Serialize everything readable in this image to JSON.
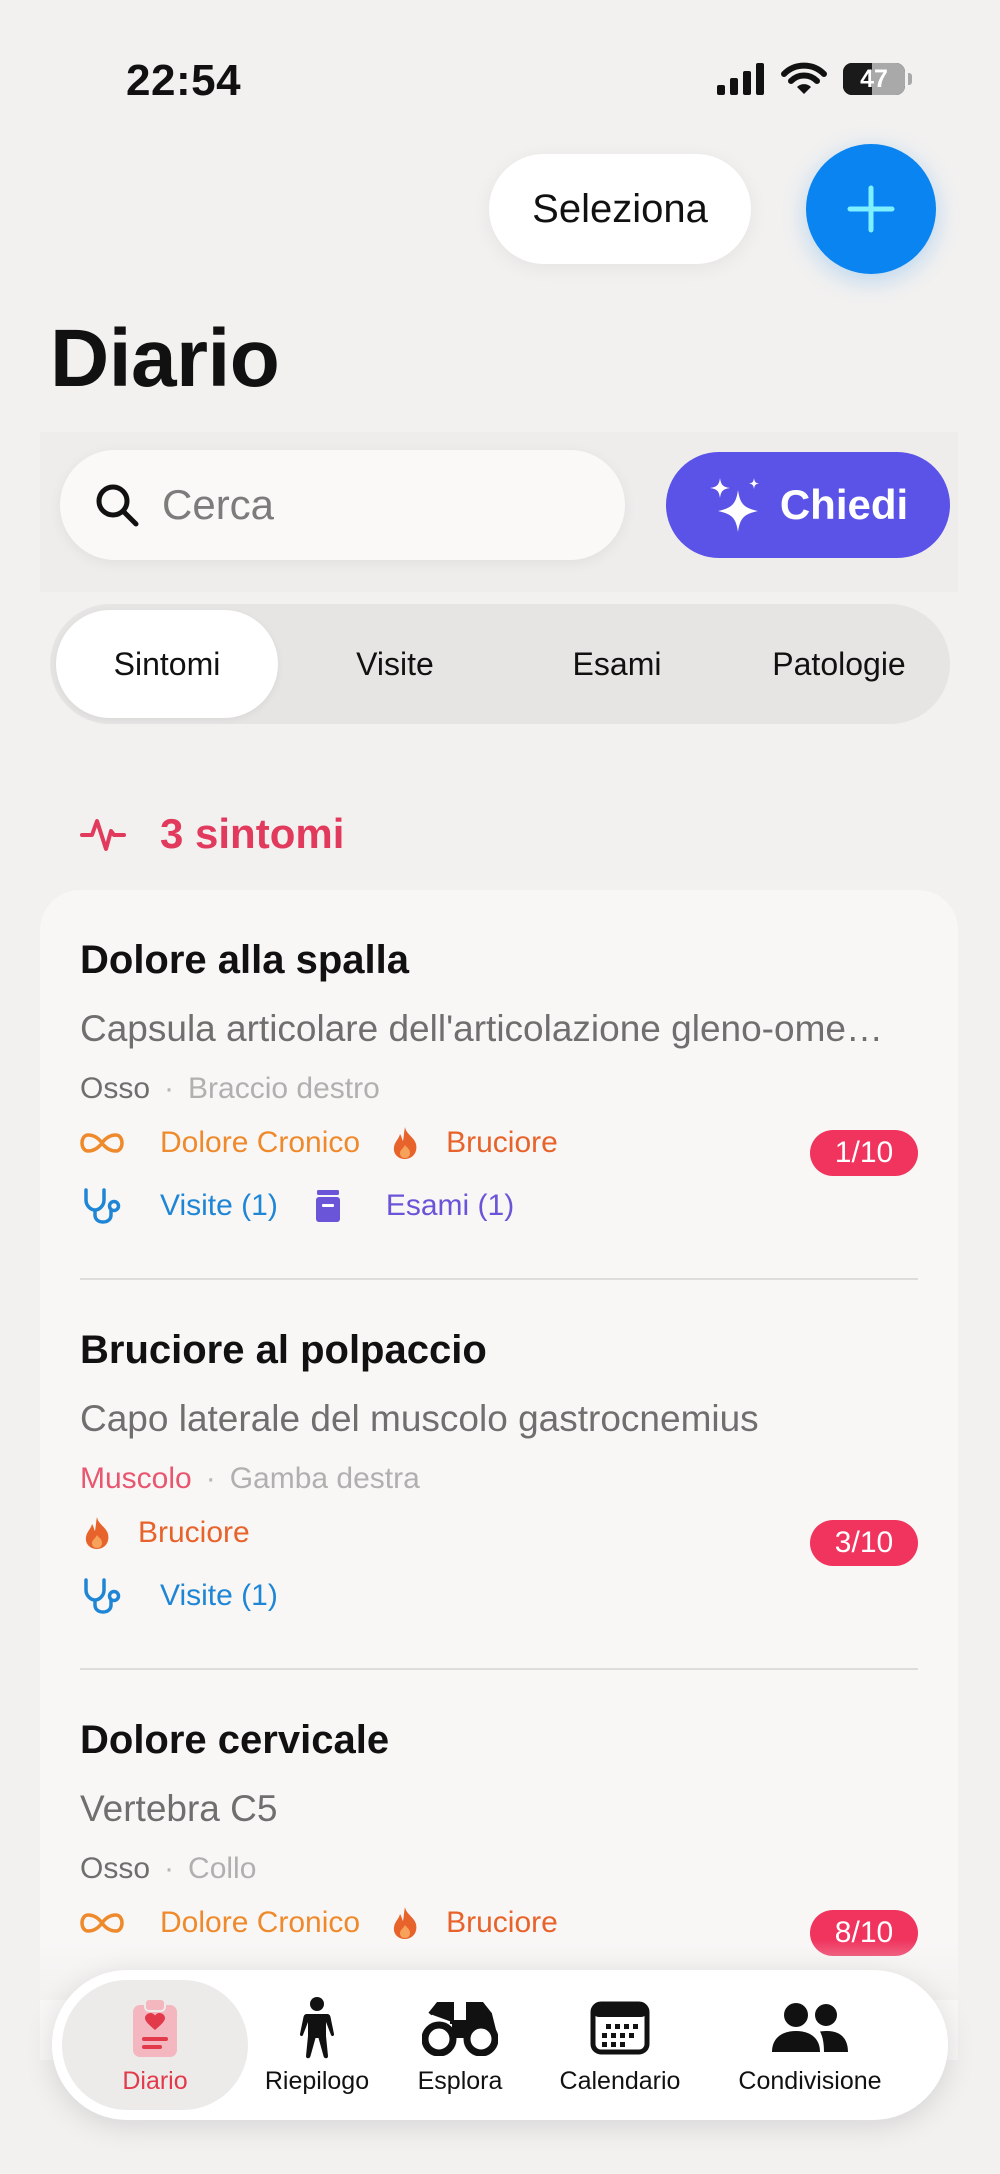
{
  "status": {
    "time": "22:54",
    "battery": "47"
  },
  "header": {
    "select_label": "Seleziona",
    "title": "Diario"
  },
  "search": {
    "placeholder": "Cerca",
    "ask_label": "Chiedi"
  },
  "tabs": [
    {
      "label": "Sintomi",
      "active": true
    },
    {
      "label": "Visite",
      "active": false
    },
    {
      "label": "Esami",
      "active": false
    },
    {
      "label": "Patologie",
      "active": false
    }
  ],
  "section": {
    "count_label": "3 sintomi"
  },
  "cards": [
    {
      "title": "Dolore alla spalla",
      "subtitle": "Capsula articolare dell'articolazione gleno-ome…",
      "type": "Osso",
      "location": "Braccio destro",
      "tags": [
        "Dolore Cronico",
        "Bruciore"
      ],
      "links": [
        "Visite (1)",
        "Esami (1)"
      ],
      "score": "1/10"
    },
    {
      "title": "Bruciore al polpaccio",
      "subtitle": "Capo laterale del muscolo gastrocnemius",
      "type": "Muscolo",
      "location": "Gamba destra",
      "tags": [
        "Bruciore"
      ],
      "links": [
        "Visite (1)"
      ],
      "score": "3/10"
    },
    {
      "title": "Dolore cervicale",
      "subtitle": "Vertebra C5",
      "type": "Osso",
      "location": "Collo",
      "tags": [
        "Dolore Cronico",
        "Bruciore"
      ],
      "score": "8/10"
    }
  ],
  "tabbar": [
    {
      "label": "Diario",
      "icon": "clipboard-heart-icon",
      "active": true
    },
    {
      "label": "Riepilogo",
      "icon": "person-icon",
      "active": false
    },
    {
      "label": "Esplora",
      "icon": "binoculars-icon",
      "active": false
    },
    {
      "label": "Calendario",
      "icon": "calendar-icon",
      "active": false
    },
    {
      "label": "Condivisione",
      "icon": "people-icon",
      "active": false
    }
  ],
  "colors": {
    "accent": "#0a84f0",
    "ask": "#5b52e8",
    "symptom": "#e23a5c",
    "score": "#f0345e"
  }
}
